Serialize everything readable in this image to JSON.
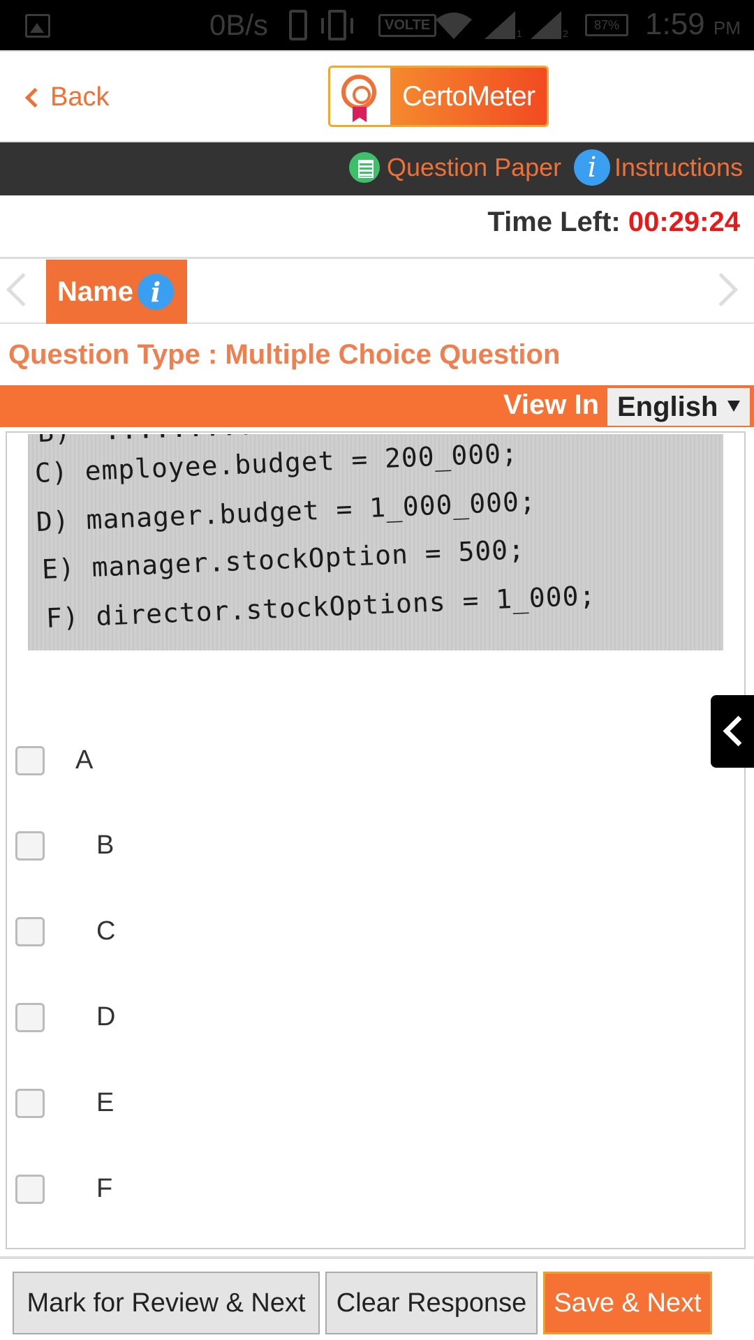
{
  "status_bar": {
    "net_speed": "0B/s",
    "volte": "VOLTE",
    "sim1": "1",
    "sim2": "2",
    "battery": "87%",
    "time": "1:59",
    "ampm": "PM"
  },
  "header": {
    "back_label": "Back",
    "logo_text": "CertoMeter"
  },
  "toolbar": {
    "question_paper": "Question Paper",
    "instructions": "Instructions",
    "info_glyph": "i"
  },
  "timer": {
    "label": "Time Left:",
    "value": "00:29:24"
  },
  "section": {
    "tab_label": "Name",
    "info_glyph": "i"
  },
  "question": {
    "type_label": "Question Type : Multiple Choice Question",
    "code_lines": [
      "B)  .............",
      "C) employee.budget = 200_000;",
      "D) manager.budget = 1_000_000;",
      "E) manager.stockOption = 500;",
      "F) director.stockOptions = 1_000;"
    ],
    "options": [
      "A",
      "B",
      "C",
      "D",
      "E",
      "F"
    ]
  },
  "view_bar": {
    "view_in": "View In",
    "language": "English"
  },
  "buttons": {
    "mark_review": "Mark for Review & Next",
    "clear": "Clear Response",
    "save_next": "Save & Next"
  },
  "colors": {
    "accent": "#f57234",
    "timer": "#e81919",
    "toolbar_bg": "#333333"
  }
}
